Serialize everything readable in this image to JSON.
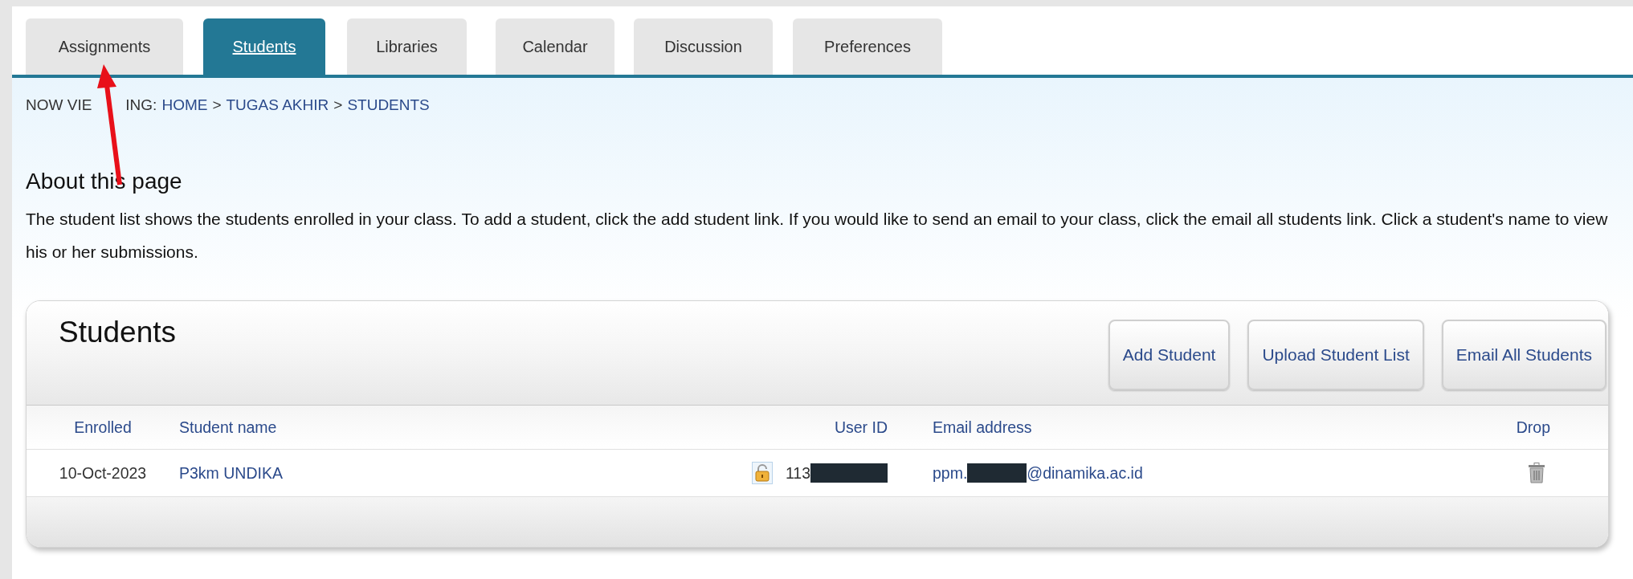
{
  "tabs": [
    {
      "label": "Assignments",
      "selected": false
    },
    {
      "label": "Students",
      "selected": true
    },
    {
      "label": "Libraries",
      "selected": false
    },
    {
      "label": "Calendar",
      "selected": false
    },
    {
      "label": "Discussion",
      "selected": false
    },
    {
      "label": "Preferences",
      "selected": false
    }
  ],
  "breadcrumb": {
    "prefix": [
      "NOW VIE",
      "ING:"
    ],
    "links": [
      "HOME",
      ">",
      "TUGAS AKHIR",
      ">",
      "STUDENTS"
    ]
  },
  "about": {
    "title": "About this page",
    "text": "The student list shows the students enrolled in your class. To add a student, click the add student link. If you would like to send an email to your class, click the email all students link. Click a student's name to view his or her submissions."
  },
  "panel": {
    "title": "Students",
    "buttons": [
      "Add Student",
      "Upload Student List",
      "Email All Students"
    ],
    "columns": [
      "Enrolled",
      "Student name",
      "User ID",
      "Email address",
      "Drop"
    ],
    "rows": [
      {
        "enrolled": "10-Oct-2023",
        "name": "P3km UNDIKA",
        "locked": false,
        "user_id": "113",
        "user_id_redacted": true,
        "email_start": "ppm.",
        "email_end": "@dinamika.ac.id",
        "email_redacted": true
      }
    ]
  }
}
